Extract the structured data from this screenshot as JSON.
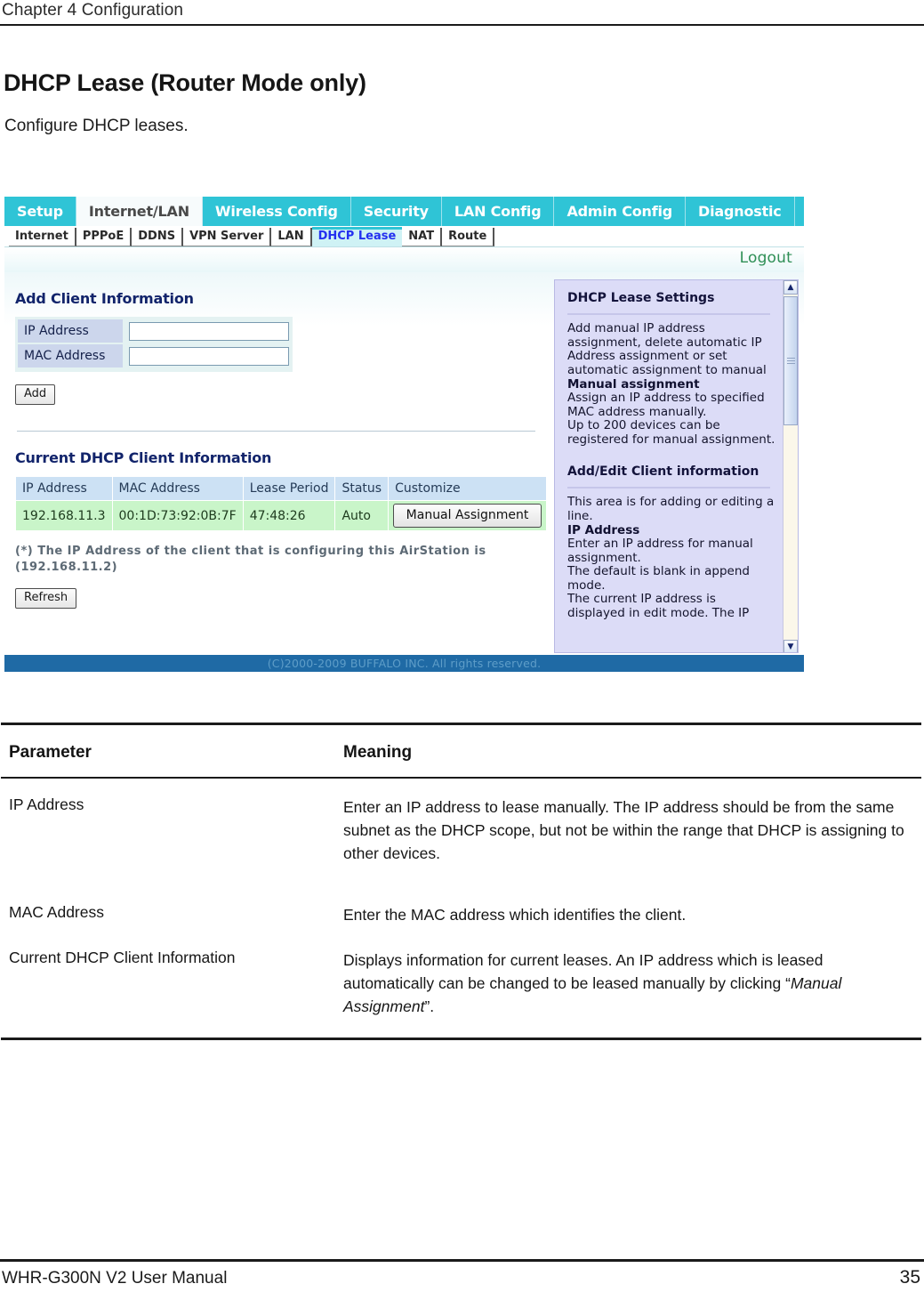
{
  "document": {
    "chapter_header": "Chapter 4  Configuration",
    "title": "DHCP Lease (Router Mode only)",
    "intro": "Configure DHCP leases.",
    "footer_manual": "WHR-G300N V2 User Manual",
    "footer_page": "35"
  },
  "screenshot": {
    "main_tabs": [
      {
        "label": "Setup",
        "active": false
      },
      {
        "label": "Internet/LAN",
        "active": true
      },
      {
        "label": "Wireless Config",
        "active": false
      },
      {
        "label": "Security",
        "active": false
      },
      {
        "label": "LAN Config",
        "active": false
      },
      {
        "label": "Admin Config",
        "active": false
      },
      {
        "label": "Diagnostic",
        "active": false
      }
    ],
    "sub_tabs": [
      {
        "label": "Internet",
        "active": false
      },
      {
        "label": "PPPoE",
        "active": false
      },
      {
        "label": "DDNS",
        "active": false
      },
      {
        "label": "VPN Server",
        "active": false
      },
      {
        "label": "LAN",
        "active": false
      },
      {
        "label": "DHCP Lease",
        "active": true
      },
      {
        "label": "NAT",
        "active": false
      },
      {
        "label": "Route",
        "active": false
      }
    ],
    "logout_label": "Logout",
    "add_client": {
      "section_title": "Add Client Information",
      "ip_label": "IP Address",
      "ip_value": "",
      "mac_label": "MAC Address",
      "mac_value": "",
      "add_button": "Add"
    },
    "current_clients": {
      "section_title": "Current DHCP Client Information",
      "columns": [
        "IP Address",
        "MAC Address",
        "Lease Period",
        "Status",
        "Customize"
      ],
      "rows": [
        {
          "ip": "192.168.11.3",
          "mac": "00:1D:73:92:0B:7F",
          "lease": "47:48:26",
          "status": "Auto",
          "action": "Manual Assignment"
        }
      ],
      "note": "(*) The IP Address of the client that is configuring this AirStation is\n(192.168.11.2)",
      "refresh_button": "Refresh"
    },
    "help": {
      "section1_title": "DHCP Lease Settings",
      "section1_body": "Add manual IP address\nassignment, delete automatic IP\nAddress assignment or set\nautomatic assignment to manual",
      "section1_bold": "Manual assignment",
      "section1_body2": "Assign an IP address to specified\nMAC address manually.\nUp to 200 devices can be\nregistered for manual assignment.",
      "section2_title": "Add/Edit Client information",
      "section2_body": "This area is for adding or editing a\nline.",
      "section2_bold": "IP Address",
      "section2_body2": "Enter an IP address for manual\nassignment.\nThe default is blank in append\nmode.\nThe current IP address is\ndisplayed in edit mode. The IP"
    },
    "copyright": "(C)2000-2009 BUFFALO INC. All rights reserved.",
    "colors": {
      "tab_cyan": "#2fc4d6",
      "active_subtab_text": "#2430f0",
      "table_header_blue": "#cce1f4",
      "table_row_green": "#c9f5c9",
      "help_panel_lavender": "#dcdcf7",
      "footer_blue": "#1f6aa5",
      "logout_green": "#2f8f56"
    }
  },
  "parameter_table": {
    "header": {
      "parameter": "Parameter",
      "meaning": "Meaning"
    },
    "rows": [
      {
        "parameter": "IP Address",
        "meaning": "Enter an IP address to lease manually. The IP address should be from the same subnet as the DHCP scope, but not be within the range that DHCP is assigning to other devices."
      },
      {
        "parameter": "MAC Address",
        "meaning": "Enter the MAC address which identifies the client."
      },
      {
        "parameter": "Current DHCP Client Information",
        "meaning_pre": "Displays information for current leases. An IP address which is leased automatically can be changed to be leased manually by clicking “",
        "meaning_em": "Manual Assignment",
        "meaning_post": "”."
      }
    ]
  }
}
